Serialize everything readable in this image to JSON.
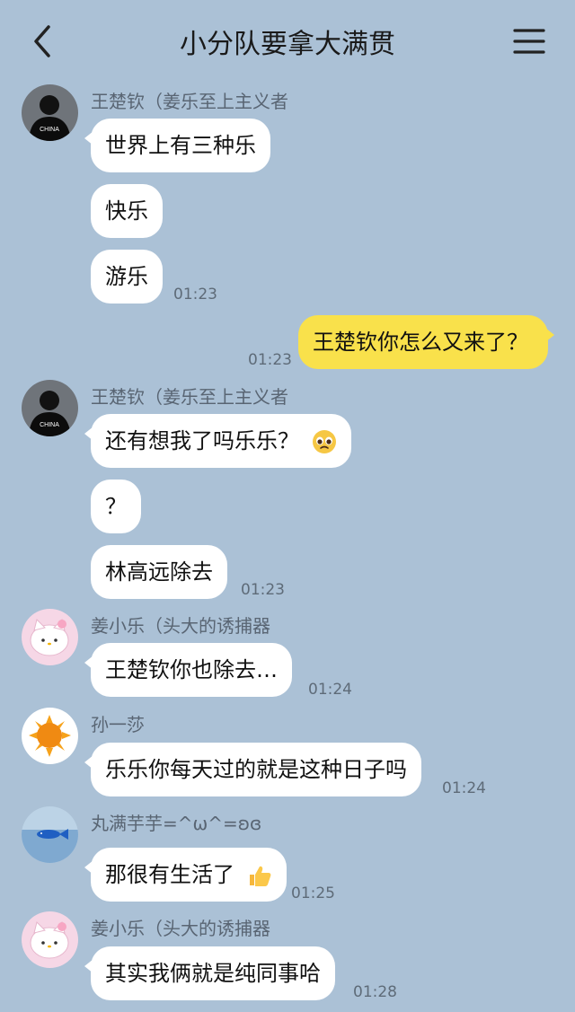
{
  "header": {
    "title": "小分队要拿大满贯",
    "back_icon": "chevron-left-icon",
    "menu_icon": "hamburger-menu-icon"
  },
  "messages": [
    {
      "sender": "王楚钦（姜乐至上主义者",
      "text": "世界上有三种乐"
    },
    {
      "text": "快乐"
    },
    {
      "text": "游乐",
      "time": "01:23"
    },
    {
      "text": "王楚钦你怎么又来了？",
      "time": "01:23",
      "outgoing": true
    },
    {
      "sender": "王楚钦（姜乐至上主义者",
      "text": "还有想我了吗乐乐？",
      "emoji": "pleading-face-emoji"
    },
    {
      "text": "？"
    },
    {
      "text": "林高远除去",
      "time": "01:23"
    },
    {
      "sender": "姜小乐（头大的诱捕器",
      "text": "王楚钦你也除去…",
      "time": "01:24"
    },
    {
      "sender": "孙一莎",
      "text": "乐乐你每天过的就是这种日子吗",
      "time": "01:24"
    },
    {
      "sender": "丸满芋芋=^ω^=ʚɞ",
      "text": "那很有生活了",
      "emoji": "thumbs-up-emoji",
      "time": "01:25"
    },
    {
      "sender": "姜小乐（头大的诱捕器",
      "text": "其实我俩就是纯同事哈",
      "time": "01:28"
    }
  ],
  "avatars": {
    "wang": {
      "icon": "person-avatar",
      "jersey_text": "CHINA"
    },
    "jiang": {
      "icon": "cartoon-cat-avatar"
    },
    "sun": {
      "icon": "sun-avatar"
    },
    "wanman": {
      "icon": "fish-avatar"
    }
  },
  "colors": {
    "background": "#abc1d6",
    "incoming_bubble": "#ffffff",
    "outgoing_bubble": "#f9e14b"
  }
}
